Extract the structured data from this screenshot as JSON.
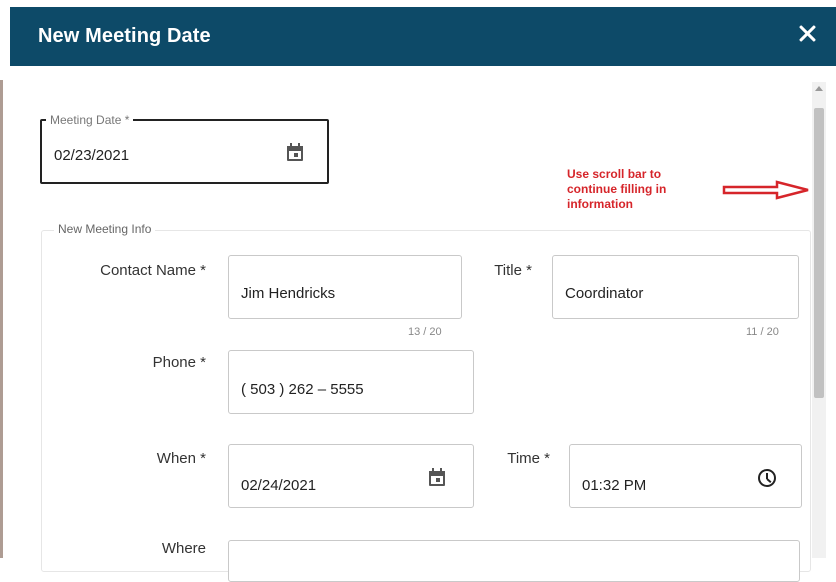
{
  "dialog": {
    "title": "New Meeting Date"
  },
  "meeting_date": {
    "label": "Meeting Date *",
    "value": "02/23/2021"
  },
  "annotation": {
    "text_line1": "Use scroll bar to",
    "text_line2": "continue filling in",
    "text_line3": "information",
    "color": "#d6252a"
  },
  "info_section": {
    "legend": "New Meeting Info",
    "contact_name": {
      "label": "Contact Name *",
      "value": "Jim Hendricks",
      "counter": "13 / 20"
    },
    "title": {
      "label": "Title *",
      "value": "Coordinator",
      "counter": "11 / 20"
    },
    "phone": {
      "label": "Phone *",
      "value": "( 503 ) 262 – 5555"
    },
    "when": {
      "label": "When *",
      "value": "02/24/2021"
    },
    "time": {
      "label": "Time *",
      "value": "01:32 PM"
    },
    "where": {
      "label": "Where",
      "value": ""
    }
  },
  "colors": {
    "header": "#0d4a68",
    "annotation": "#d6252a"
  },
  "icons": [
    "close-icon",
    "calendar-icon",
    "clock-icon",
    "arrow-right-icon",
    "scroll-up-icon"
  ]
}
